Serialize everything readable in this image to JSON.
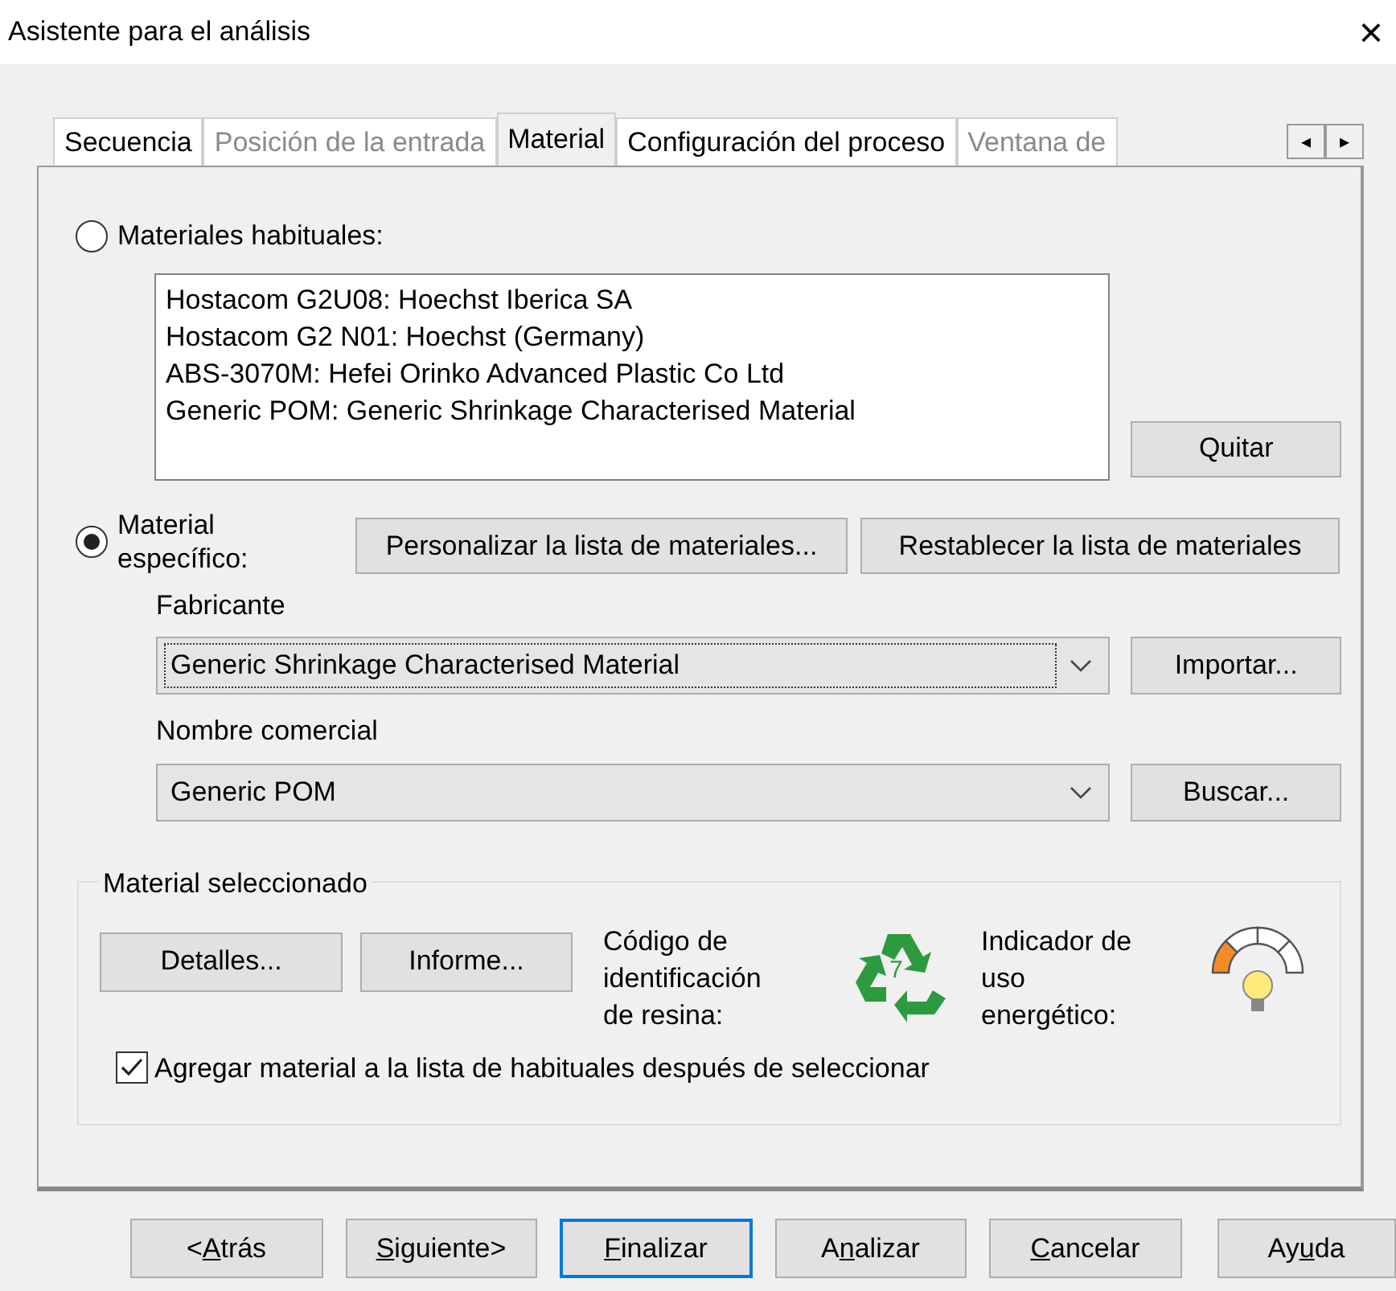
{
  "window": {
    "title": "Asistente para el análisis",
    "close": "×"
  },
  "tabs": [
    {
      "label": "Secuencia",
      "selected": false,
      "disabled": false
    },
    {
      "label": "Posición de la entrada",
      "selected": false,
      "disabled": true
    },
    {
      "label": "Material",
      "selected": true,
      "disabled": false
    },
    {
      "label": "Configuración del proceso",
      "selected": false,
      "disabled": false
    },
    {
      "label": "Ventana de",
      "selected": false,
      "disabled": true
    }
  ],
  "tab_scroll": [
    "◂",
    "▸"
  ],
  "common": {
    "label": "Materiales habituales:",
    "selected": false,
    "items": [
      "Hostacom G2U08: Hoechst Iberica SA",
      "Hostacom G2 N01: Hoechst (Germany)",
      "ABS-3070M: Hefei Orinko Advanced Plastic Co Ltd",
      "Generic POM: Generic Shrinkage Characterised Material"
    ],
    "remove_button": "Quitar"
  },
  "specific": {
    "label_lines": [
      "Material",
      "específico:"
    ],
    "selected": true,
    "customize_button": "Personalizar la lista de materiales...",
    "reset_button": "Restablecer la lista de materiales",
    "manufacturer": {
      "label": "Fabricante",
      "value": "Generic Shrinkage Characterised Material",
      "focused": true,
      "button": "Importar..."
    },
    "trade_name": {
      "label": "Nombre comercial",
      "value": "Generic POM",
      "focused": false,
      "button": "Buscar..."
    }
  },
  "selected_material": {
    "title": "Material seleccionado",
    "details_button": "Detalles...",
    "report_button": "Informe...",
    "resin_code_label": "Código de identificación de resina:",
    "resin_code": "7",
    "energy_label": "Indicador de uso energético:",
    "add_to_common": {
      "label": "Agregar material a la lista de habituales después de seleccionar",
      "checked": true
    }
  },
  "footer_buttons": [
    {
      "pre": "<",
      "key": "A",
      "post": "trás",
      "focused": false
    },
    {
      "key": "S",
      "post": "iguiente>",
      "focused": false
    },
    {
      "key": "F",
      "post": "inalizar",
      "focused": true
    },
    {
      "pre": "A",
      "key": "n",
      "post": "alizar",
      "focused": false
    },
    {
      "key": "C",
      "post": "ancelar",
      "focused": false
    },
    {
      "pre": "Ay",
      "key": "u",
      "post": "da",
      "focused": false
    }
  ]
}
